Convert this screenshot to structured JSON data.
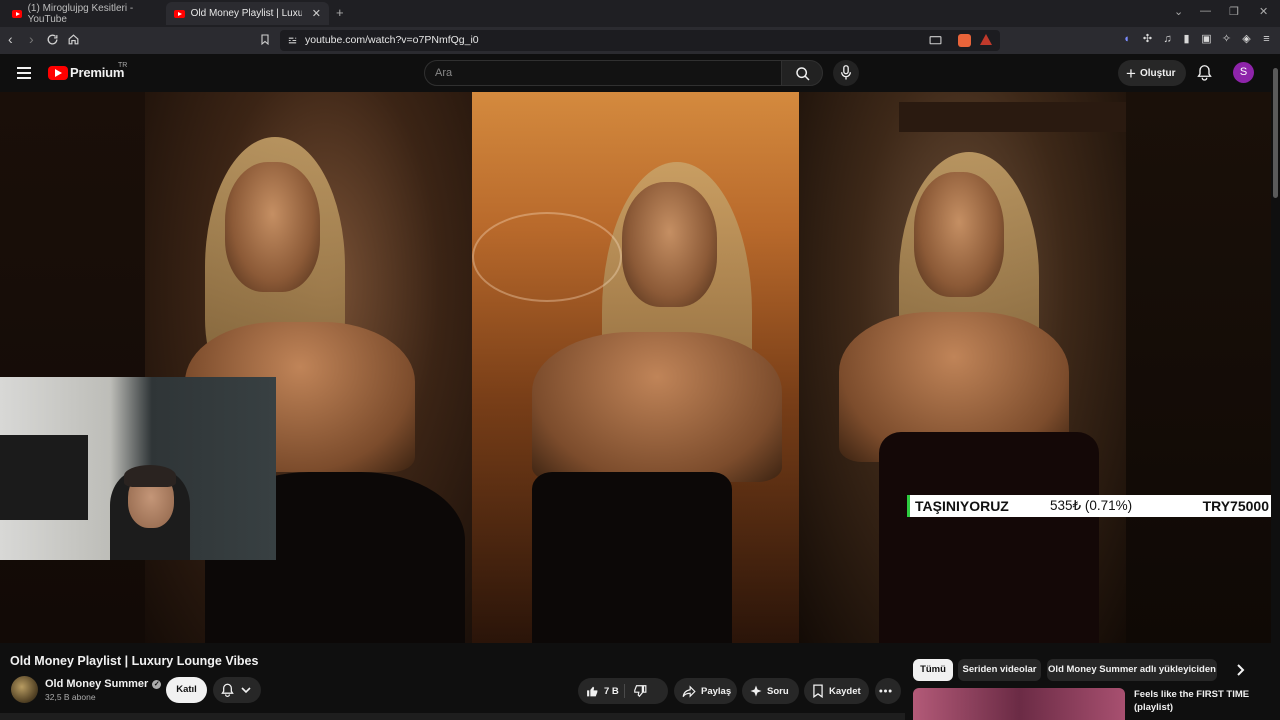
{
  "browser": {
    "tabs": [
      {
        "title": "(1) Miroglujpg Kesitleri - YouTube",
        "active": false
      },
      {
        "title": "Old Money Playlist | Luxury Lounge",
        "active": true
      }
    ],
    "new_tab": "+",
    "url": "youtube.com/watch?v=o7PNmfQg_i0"
  },
  "youtube": {
    "logo_text": "Premium",
    "logo_country": "TR",
    "search_placeholder": "Ara",
    "create_label": "Oluştur",
    "avatar_letter": "S"
  },
  "video": {
    "ticker": {
      "name": "TAŞINIYORUZ",
      "change": "535₺ (0.71%)",
      "value": "TRY75000"
    }
  },
  "watch": {
    "title": "Old Money Playlist | Luxury Lounge Vibes",
    "channel_name": "Old Money Summer",
    "subscribers": "32,5 B abone",
    "join_label": "Katıl",
    "likes": "7 B",
    "share_label": "Paylaş",
    "ask_label": "Soru",
    "save_label": "Kaydet"
  },
  "sidebar": {
    "chips": [
      "Tümü",
      "Seriden videolar",
      "Old Money Summer adlı yükleyiciden"
    ],
    "rec_title": "Feels like the FIRST TIME (playlist)"
  },
  "colors": {
    "brand_red": "#ff0000",
    "avatar_purple": "#8e24aa",
    "ticker_green": "#2ecc40"
  }
}
